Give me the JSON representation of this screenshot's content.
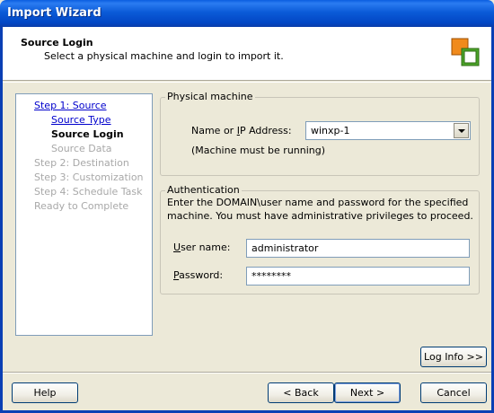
{
  "window": {
    "title": "Import Wizard"
  },
  "header": {
    "title": "Source Login",
    "subtitle": "Select a physical machine and login to import it."
  },
  "steps": [
    {
      "label": "Step 1: Source",
      "state": "link"
    },
    {
      "label": "Source Type",
      "state": "link"
    },
    {
      "label": "Source Login",
      "state": "current"
    },
    {
      "label": "Source Data",
      "state": "disabled"
    },
    {
      "label": "Step 2: Destination",
      "state": "disabled"
    },
    {
      "label": "Step 3: Customization",
      "state": "disabled"
    },
    {
      "label": "Step 4: Schedule Task",
      "state": "disabled"
    },
    {
      "label": "Ready to Complete",
      "state": "disabled"
    }
  ],
  "physical_machine": {
    "legend": "Physical machine",
    "name_label_pre": "Name or ",
    "name_label_accel": "I",
    "name_label_post": "P Address:",
    "selected_value": "winxp-1",
    "note": "(Machine must be running)"
  },
  "authentication": {
    "legend": "Authentication",
    "description_line1": "Enter the DOMAIN\\user name and password for the specified",
    "description_line2": "machine. You must have administrative privileges to proceed.",
    "username_label_accel": "U",
    "username_label_post": "ser name:",
    "username_value": "administrator",
    "password_label_accel": "P",
    "password_label_post": "assword:",
    "password_value": "********"
  },
  "buttons": {
    "log_info": "Log Info >>",
    "help": "Help",
    "back": "< Back",
    "next": "Next >",
    "cancel": "Cancel"
  }
}
